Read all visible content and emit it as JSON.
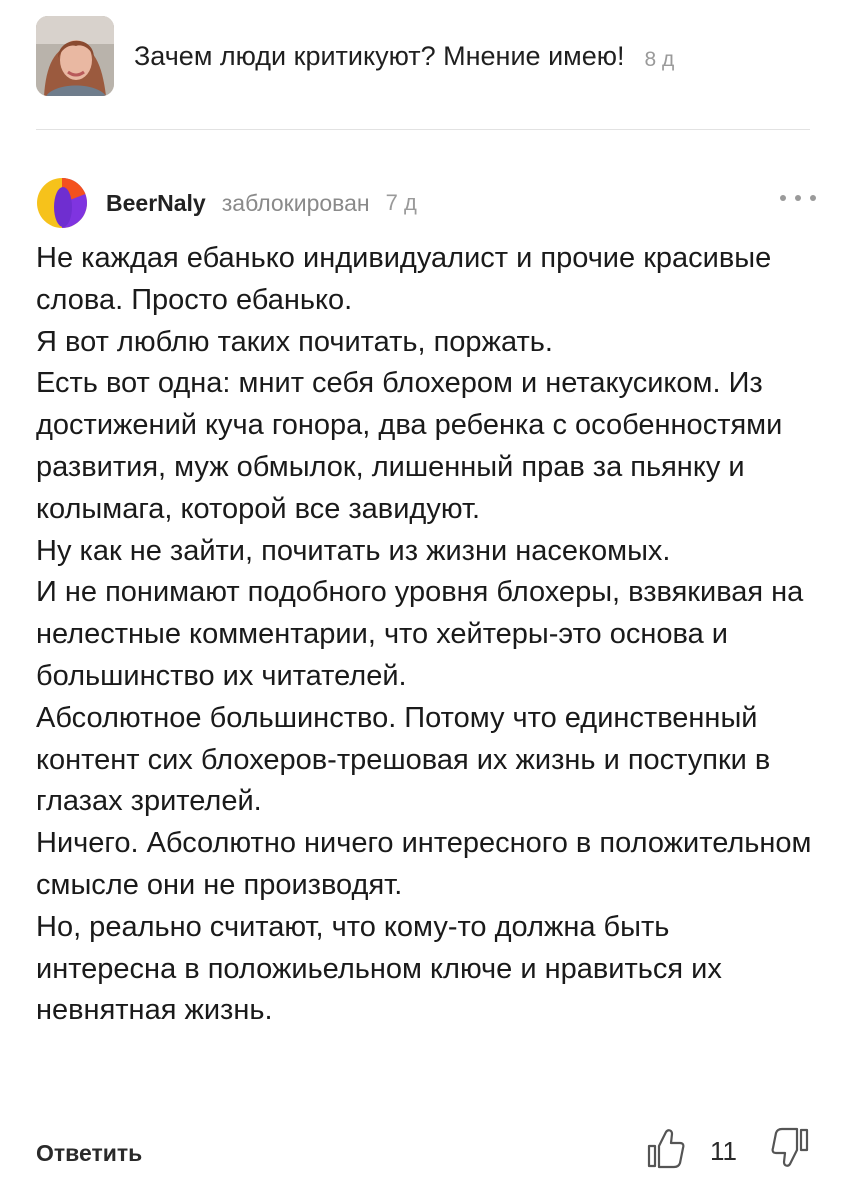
{
  "post": {
    "title": "Зачем люди критикуют? Мнение имею!",
    "age": "8 д",
    "avatar_icon": "user-photo-avatar"
  },
  "comment": {
    "username": "BeerNaly",
    "status": "заблокирован",
    "age": "7 д",
    "avatar_icon": "multicolor-circle-avatar",
    "more_icon": "more-dots-icon",
    "paragraphs": [
      "Не каждая ебанько индивидуалист и прочие красивые слова. Просто ебанько.",
      "Я вот люблю таких почитать, поржать.",
      "Есть вот одна: мнит себя блохером и нетакусиком. Из достижений куча гонора, два ребенка с особенностями развития, муж обмылок, лишенный прав за пьянку и колымага, которой все завидуют.",
      "Ну как не зайти, почитать из жизни насекомых.",
      "И не понимают подобного уровня блохеры, взвякивая на нелестные комментарии, что хейтеры-это основа и большинство их читателей.",
      "Абсолютное большинство. Потому что единственный контент сих блохеров-трешовая их жизнь и поступки в глазах зрителей.",
      "Ничего. Абсолютно ничего интересного в положительном смысле они не производят.",
      "Но, реально считают, что кому-то должна быть интересна в положиьельном ключе и нравиться их невнятная жизнь."
    ]
  },
  "actions": {
    "reply_label": "Ответить",
    "like_count": "11",
    "like_icon": "thumbs-up-icon",
    "dislike_icon": "thumbs-down-icon"
  },
  "colors": {
    "avatar_yellow": "#f6c21b",
    "avatar_purple": "#7f34e0",
    "avatar_orange": "#f4511e",
    "text": "#1a1a1a",
    "muted": "#9a9a9a"
  }
}
